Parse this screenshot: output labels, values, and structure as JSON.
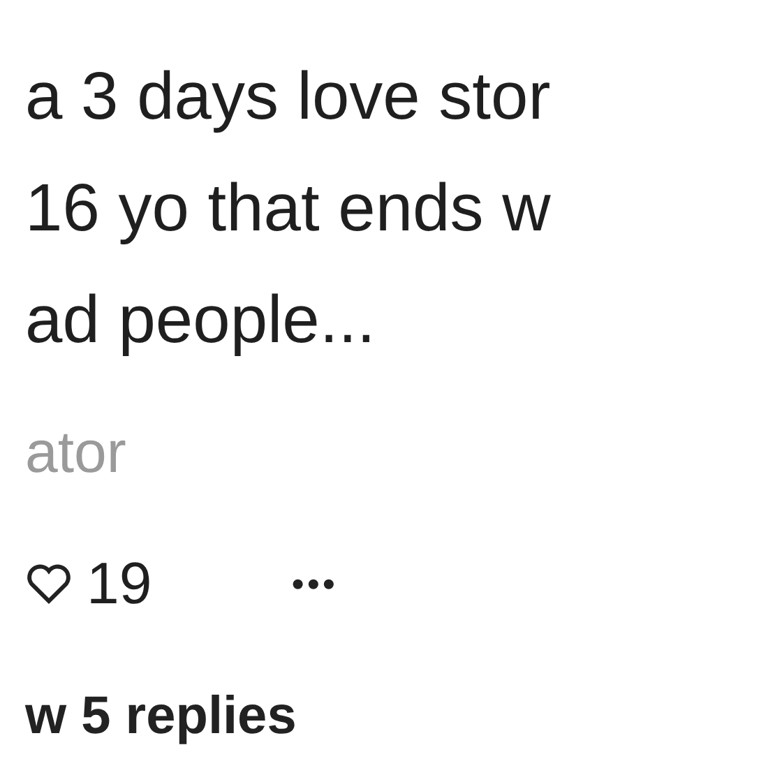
{
  "comment": {
    "lines": [
      "a 3 days love stor",
      "16 yo that ends w",
      "ad people..."
    ],
    "author_role": "ator",
    "likes": "19",
    "more": "•••",
    "replies": "w 5 replies"
  }
}
